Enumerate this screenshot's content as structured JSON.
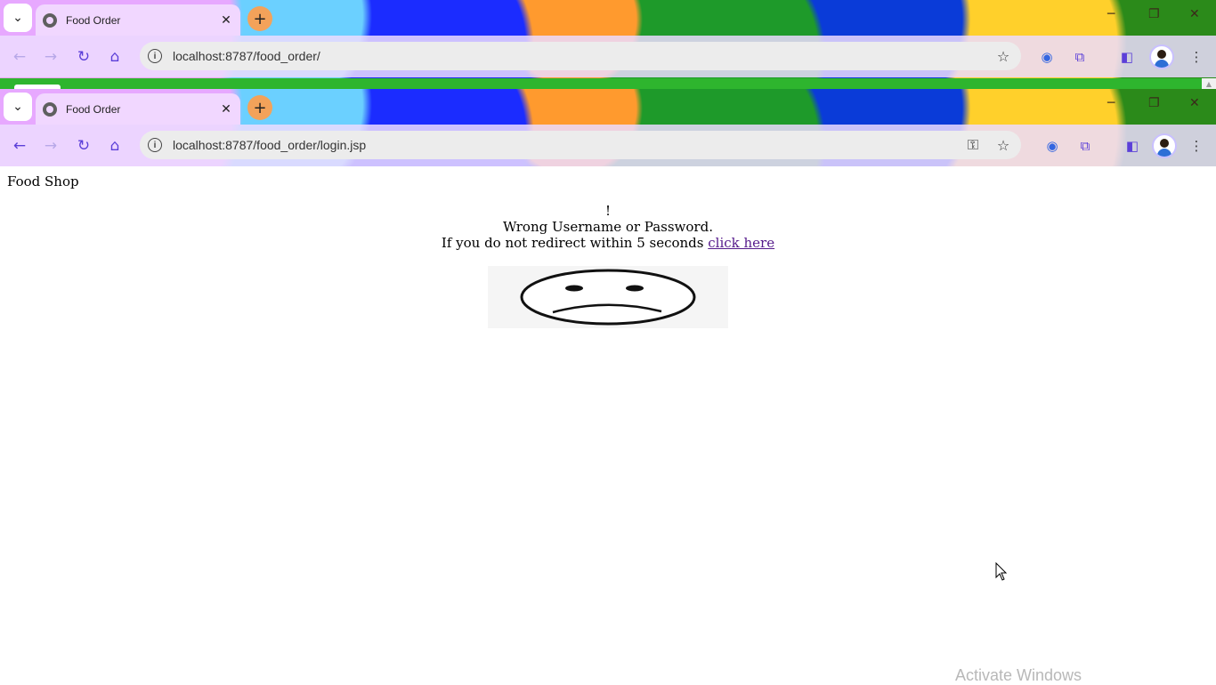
{
  "browser_outer": {
    "tab_title": "Food Order",
    "url": "localhost:8787/food_order/"
  },
  "browser_inner": {
    "tab_title": "Food Order",
    "url": "localhost:8787/food_order/login.jsp"
  },
  "page": {
    "site_title": "Food Shop",
    "exclamation": "!",
    "error_message": "Wrong Username or Password.",
    "redirect_text": "If you do not redirect within 5 seconds",
    "redirect_link": "click here"
  },
  "os": {
    "watermark": "Activate Windows"
  },
  "icons": {
    "tab_search": "chevron-down-icon",
    "tab_favicon": "globe-icon",
    "tab_close": "close-icon",
    "new_tab": "plus-icon",
    "back": "back-arrow-icon",
    "forward": "forward-arrow-icon",
    "reload": "reload-icon",
    "home": "home-icon",
    "site_info": "info-icon",
    "password_key": "key-icon",
    "bookmark": "star-icon",
    "extension": "puzzle-icon",
    "side_panel": "side-panel-icon",
    "menu": "kebab-menu-icon",
    "sad_face": "sad-face-icon"
  },
  "colors": {
    "link": "#551a8b",
    "green_strip": "#2eb52e",
    "accent": "#5b3fd8"
  }
}
